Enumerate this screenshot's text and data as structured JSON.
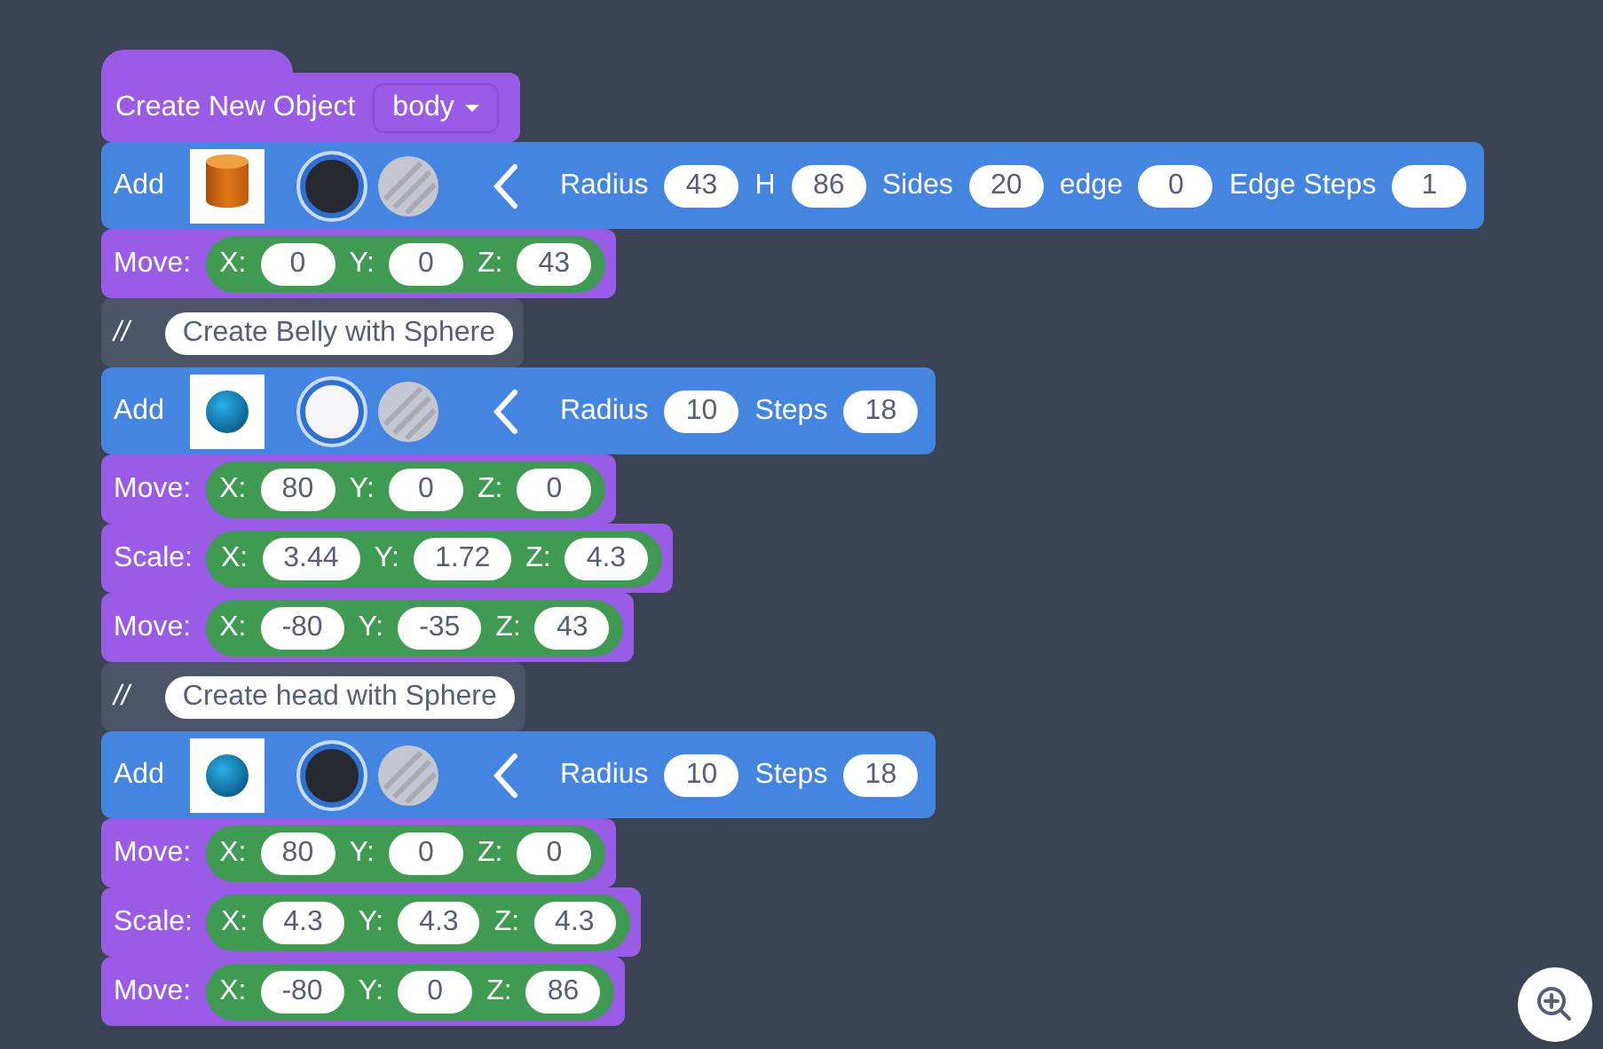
{
  "blocks": [
    {
      "kind": "hat",
      "label": "Create New Object",
      "dropdown": "body"
    },
    {
      "kind": "add",
      "label": "Add",
      "thumbnail": {
        "kind": "cylinder"
      },
      "color": "#262a30",
      "params": [
        {
          "label": "Radius",
          "value": "43"
        },
        {
          "label": "H",
          "value": "86"
        },
        {
          "label": "Sides",
          "value": "20"
        },
        {
          "label": "edge",
          "value": "0"
        },
        {
          "label": "Edge Steps",
          "value": "1"
        }
      ]
    },
    {
      "kind": "transform",
      "label": "Move:",
      "fields": [
        {
          "label": "X:",
          "value": "0"
        },
        {
          "label": "Y:",
          "value": "0"
        },
        {
          "label": "Z:",
          "value": "43"
        }
      ]
    },
    {
      "kind": "comment",
      "label": "//",
      "text": "Create Belly with Sphere"
    },
    {
      "kind": "add",
      "label": "Add",
      "thumbnail": {
        "kind": "sphere"
      },
      "color": "#f5f5f7",
      "params": [
        {
          "label": "Radius",
          "value": "10"
        },
        {
          "label": "Steps",
          "value": "18"
        }
      ]
    },
    {
      "kind": "transform",
      "label": "Move:",
      "fields": [
        {
          "label": "X:",
          "value": "80"
        },
        {
          "label": "Y:",
          "value": "0"
        },
        {
          "label": "Z:",
          "value": "0"
        }
      ]
    },
    {
      "kind": "transform",
      "label": "Scale:",
      "fields": [
        {
          "label": "X:",
          "value": "3.44"
        },
        {
          "label": "Y:",
          "value": "1.72"
        },
        {
          "label": "Z:",
          "value": "4.3"
        }
      ]
    },
    {
      "kind": "transform",
      "label": "Move:",
      "fields": [
        {
          "label": "X:",
          "value": "-80"
        },
        {
          "label": "Y:",
          "value": "-35"
        },
        {
          "label": "Z:",
          "value": "43"
        }
      ]
    },
    {
      "kind": "comment",
      "label": "//",
      "text": "Create head with Sphere"
    },
    {
      "kind": "add",
      "label": "Add",
      "thumbnail": {
        "kind": "sphere"
      },
      "color": "#262a30",
      "params": [
        {
          "label": "Radius",
          "value": "10"
        },
        {
          "label": "Steps",
          "value": "18"
        }
      ]
    },
    {
      "kind": "transform",
      "label": "Move:",
      "fields": [
        {
          "label": "X:",
          "value": "80"
        },
        {
          "label": "Y:",
          "value": "0"
        },
        {
          "label": "Z:",
          "value": "0"
        }
      ]
    },
    {
      "kind": "transform",
      "label": "Scale:",
      "fields": [
        {
          "label": "X:",
          "value": "4.3"
        },
        {
          "label": "Y:",
          "value": "4.3"
        },
        {
          "label": "Z:",
          "value": "4.3"
        }
      ]
    },
    {
      "kind": "transform",
      "label": "Move:",
      "fields": [
        {
          "label": "X:",
          "value": "-80"
        },
        {
          "label": "Y:",
          "value": "0"
        },
        {
          "label": "Z:",
          "value": "86"
        }
      ]
    }
  ]
}
